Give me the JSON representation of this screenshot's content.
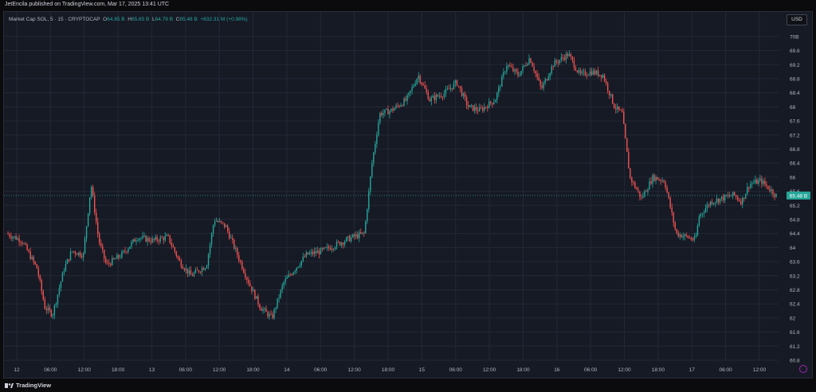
{
  "header": {
    "published": "JetEncila published on TradingView.com, Mar 17, 2025 13:41 UTC"
  },
  "legend": {
    "symbol": "Market Cap SOL, 5 · 15 · CRYPTOCAP",
    "open_label": "O",
    "open": "64.85 B",
    "high_label": "H",
    "high": "65.65 B",
    "low_label": "L",
    "low": "64.79 B",
    "close_label": "C",
    "close": "65.48 B",
    "change": "+632.31 M (+0.98%)"
  },
  "currency_button": "USD",
  "footer": {
    "brand": "TradingView"
  },
  "colors": {
    "up": "#26a69a",
    "down": "#ef5350",
    "background": "#161a25",
    "grid": "#242836"
  },
  "chart_data": {
    "type": "candlestick",
    "y_unit": "B",
    "ylim": [
      60.8,
      70.2
    ],
    "y_ticks": [
      "70B",
      "69.6",
      "69.2",
      "68.8",
      "68.4",
      "68",
      "67.6",
      "67.2",
      "66.8",
      "66.4",
      "66",
      "65.6",
      "65.2",
      "64.8",
      "64.4",
      "64",
      "63.6",
      "63.2",
      "62.8",
      "62.4",
      "62",
      "61.6",
      "61.2",
      "60.8"
    ],
    "x_tick_labels": [
      "12",
      "06:00",
      "12:00",
      "18:00",
      "13",
      "06:00",
      "12:00",
      "18:00",
      "14",
      "06:00",
      "12:00",
      "18:00",
      "15",
      "06:00",
      "12:00",
      "18:00",
      "16",
      "06:00",
      "12:00",
      "18:00",
      "17",
      "06:00",
      "12:00"
    ],
    "last_price_label": "65.48 B",
    "last_price": 65.48,
    "price_path": [
      [
        0,
        64.4
      ],
      [
        0.02,
        64.2
      ],
      [
        0.04,
        63.4
      ],
      [
        0.05,
        62.3
      ],
      [
        0.06,
        62.1
      ],
      [
        0.075,
        63.4
      ],
      [
        0.085,
        63.9
      ],
      [
        0.1,
        63.8
      ],
      [
        0.11,
        65.8
      ],
      [
        0.12,
        64.2
      ],
      [
        0.13,
        63.5
      ],
      [
        0.15,
        63.8
      ],
      [
        0.17,
        64.3
      ],
      [
        0.19,
        64.2
      ],
      [
        0.21,
        64.3
      ],
      [
        0.225,
        63.6
      ],
      [
        0.24,
        63.2
      ],
      [
        0.26,
        63.5
      ],
      [
        0.27,
        64.8
      ],
      [
        0.285,
        64.6
      ],
      [
        0.3,
        63.8
      ],
      [
        0.315,
        63.0
      ],
      [
        0.33,
        62.3
      ],
      [
        0.345,
        62.0
      ],
      [
        0.36,
        63.0
      ],
      [
        0.375,
        63.4
      ],
      [
        0.39,
        63.8
      ],
      [
        0.41,
        63.9
      ],
      [
        0.43,
        64.1
      ],
      [
        0.45,
        64.3
      ],
      [
        0.465,
        64.4
      ],
      [
        0.475,
        66.4
      ],
      [
        0.485,
        67.8
      ],
      [
        0.5,
        67.9
      ],
      [
        0.52,
        68.2
      ],
      [
        0.535,
        68.9
      ],
      [
        0.55,
        68.2
      ],
      [
        0.57,
        68.4
      ],
      [
        0.585,
        68.7
      ],
      [
        0.6,
        68.0
      ],
      [
        0.615,
        67.9
      ],
      [
        0.635,
        68.2
      ],
      [
        0.65,
        69.2
      ],
      [
        0.665,
        68.9
      ],
      [
        0.68,
        69.4
      ],
      [
        0.695,
        68.5
      ],
      [
        0.71,
        69.2
      ],
      [
        0.73,
        69.5
      ],
      [
        0.745,
        68.9
      ],
      [
        0.76,
        69.0
      ],
      [
        0.775,
        68.9
      ],
      [
        0.79,
        68.0
      ],
      [
        0.8,
        67.8
      ],
      [
        0.81,
        66.0
      ],
      [
        0.825,
        65.4
      ],
      [
        0.84,
        66.0
      ],
      [
        0.855,
        65.9
      ],
      [
        0.87,
        64.4
      ],
      [
        0.885,
        64.3
      ],
      [
        0.895,
        64.2
      ],
      [
        0.9,
        64.9
      ],
      [
        0.915,
        65.3
      ],
      [
        0.93,
        65.4
      ],
      [
        0.945,
        65.5
      ],
      [
        0.955,
        65.3
      ],
      [
        0.965,
        65.8
      ],
      [
        0.98,
        65.9
      ],
      [
        0.99,
        65.7
      ],
      [
        1.0,
        65.48
      ]
    ]
  }
}
